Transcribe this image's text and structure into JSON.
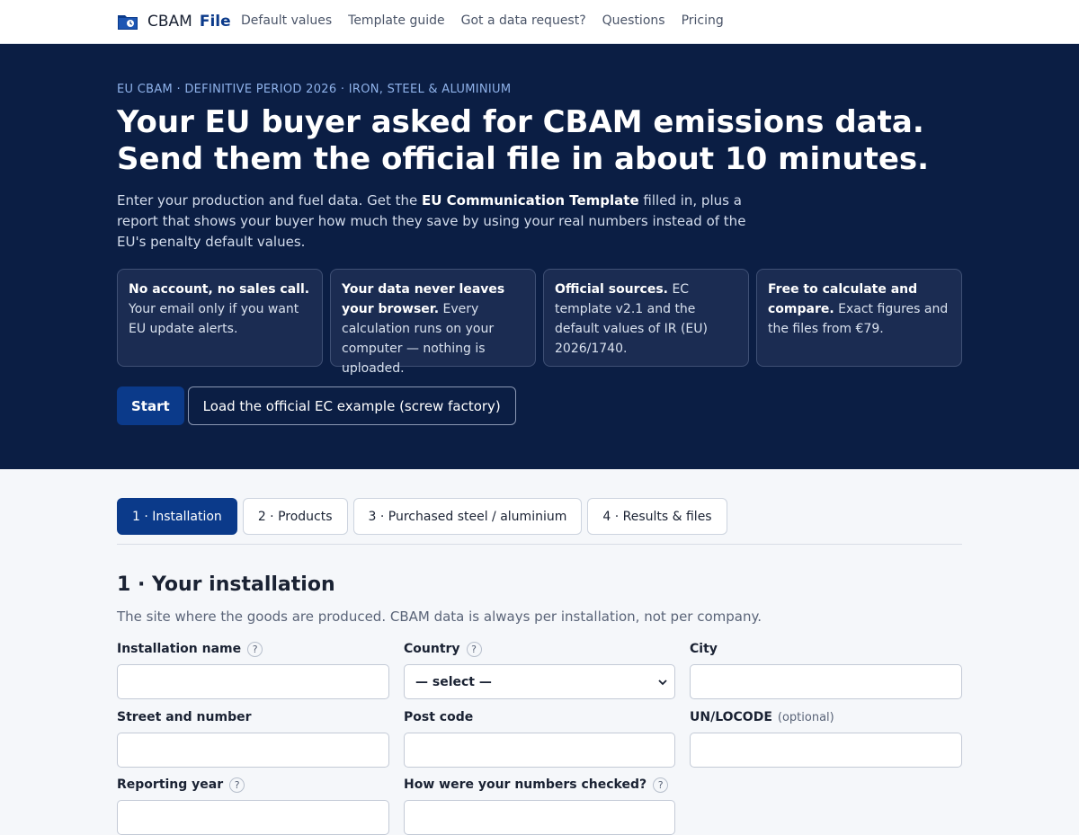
{
  "nav": {
    "brand_prefix": "CBAM",
    "brand_suffix": "File",
    "links": [
      "Default values",
      "Template guide",
      "Got a data request?",
      "Questions",
      "Pricing"
    ]
  },
  "hero": {
    "eyebrow": "EU CBAM · DEFINITIVE PERIOD 2026 · IRON, STEEL & ALUMINIUM",
    "title_line1": "Your EU buyer asked for CBAM emissions data.",
    "title_line2": "Send them the official file in about 10 minutes.",
    "lead_before": "Enter your production and fuel data. Get the ",
    "lead_bold": "EU Communication Template",
    "lead_after": " filled in, plus a report that shows your buyer how much they save by using your real numbers instead of the EU's penalty default values.",
    "cards": [
      {
        "bold": "No account, no sales call.",
        "text": " Your email only if you want EU update alerts."
      },
      {
        "bold": "Your data never leaves your browser.",
        "text": " Every calculation runs on your computer — nothing is uploaded."
      },
      {
        "bold": "Official sources.",
        "text": " EC template v2.1 and the default values of IR (EU) 2026/1740."
      },
      {
        "bold": "Free to calculate and compare.",
        "text": " Exact figures and the files from €79."
      }
    ],
    "start_label": "Start",
    "example_label": "Load the official EC example (screw factory)"
  },
  "tabs": [
    {
      "label": "1 · Installation",
      "active": true
    },
    {
      "label": "2 · Products",
      "active": false
    },
    {
      "label": "3 · Purchased steel / aluminium",
      "active": false
    },
    {
      "label": "4 · Results & files",
      "active": false
    }
  ],
  "form": {
    "title": "1 · Your installation",
    "subtitle": "The site where the goods are produced. CBAM data is always per installation, not per company.",
    "installation_name_label": "Installation name",
    "country_label": "Country",
    "country_value": "— select —",
    "city_label": "City",
    "street_label": "Street and number",
    "postcode_label": "Post code",
    "unlocode_label": "UN/LOCODE",
    "optional_note": "(optional)",
    "reporting_year_label": "Reporting year",
    "verification_label": "How were your numbers checked?",
    "help_glyph": "?"
  },
  "colors": {
    "hero_bg": "#0b1e44",
    "accent": "#0b3a8a",
    "page_bg": "#f5f7fa"
  }
}
